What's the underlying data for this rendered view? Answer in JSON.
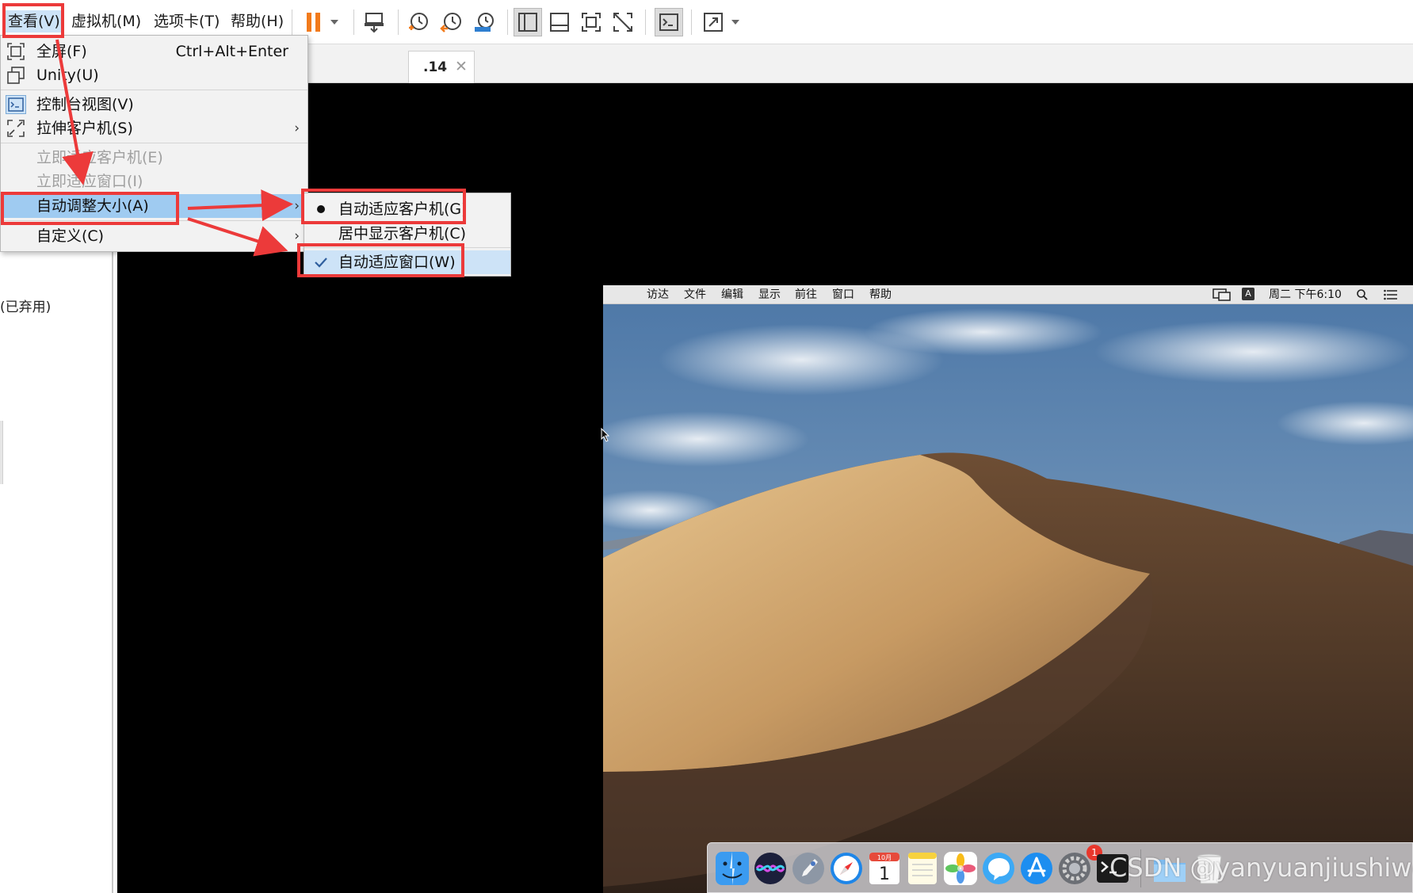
{
  "menubar": {
    "menus": [
      {
        "id": "view",
        "label": "查看(V)"
      },
      {
        "id": "vm",
        "label": "虚拟机(M)"
      },
      {
        "id": "tabs",
        "label": "选项卡(T)"
      },
      {
        "id": "help",
        "label": "帮助(H)"
      }
    ],
    "toolbar_icons": [
      "pause-icon",
      "dropdown-arrow-icon",
      "send-ctrl-alt-del-icon",
      "snapshot-take-icon",
      "snapshot-revert-icon",
      "snapshot-manager-icon",
      "library-view-icon",
      "thumbnail-bar-icon",
      "fullscreen-icon",
      "unity-disabled-icon",
      "console-view-icon",
      "stretch-guest-icon",
      "dropdown-arrow-icon"
    ]
  },
  "view_menu": {
    "items": [
      {
        "label": "全屏(F)",
        "accel": "Ctrl+Alt+Enter",
        "icon": "fullscreen-icon",
        "enabled": true
      },
      {
        "label": "Unity(U)",
        "icon": "unity-icon",
        "enabled": true
      },
      {
        "label": "控制台视图(V)",
        "icon": "console-view-icon",
        "enabled": true
      },
      {
        "label": "拉伸客户机(S)",
        "icon": "stretch-icon",
        "enabled": true,
        "submenu": true
      },
      {
        "label": "立即适应客户机(E)",
        "enabled": false
      },
      {
        "label": "立即适应窗口(I)",
        "enabled": false
      },
      {
        "label": "自动调整大小(A)",
        "enabled": true,
        "submenu": true,
        "highlighted": true
      },
      {
        "label": "自定义(C)",
        "enabled": true,
        "submenu": true
      }
    ]
  },
  "autosize_submenu": {
    "items": [
      {
        "label": "自动适应客户机(G)",
        "mark": "bullet"
      },
      {
        "label": "居中显示客户机(C)",
        "mark": "none"
      },
      {
        "label": "自动适应窗口(W)",
        "mark": "check"
      }
    ]
  },
  "library": {
    "deprecated_label": "(已弃用)"
  },
  "vm_tab": {
    "label": ".14",
    "close_glyph": "✕"
  },
  "mac_guest": {
    "apple_glyph": "",
    "menus": [
      "访达",
      "文件",
      "编辑",
      "显示",
      "前往",
      "窗口",
      "帮助"
    ],
    "input_badge": "A",
    "clock": "周二 下午6:10",
    "calendar_month": "10月",
    "calendar_day": "1",
    "notification_count": "1",
    "dock_icons": [
      "finder-icon",
      "siri-icon",
      "launchpad-icon",
      "safari-icon",
      "calendar-icon",
      "notes-icon",
      "photos-icon",
      "messages-icon",
      "app-store-icon",
      "system-preferences-icon",
      "terminal-icon",
      "downloads-folder-icon",
      "trash-icon"
    ]
  },
  "watermark": "CSDN @yanyuanjiushiwo",
  "colors": {
    "annotation_red": "#ec3a3a",
    "menu_highlight": "#9fcbf1",
    "pause_orange": "#f27a1a"
  }
}
